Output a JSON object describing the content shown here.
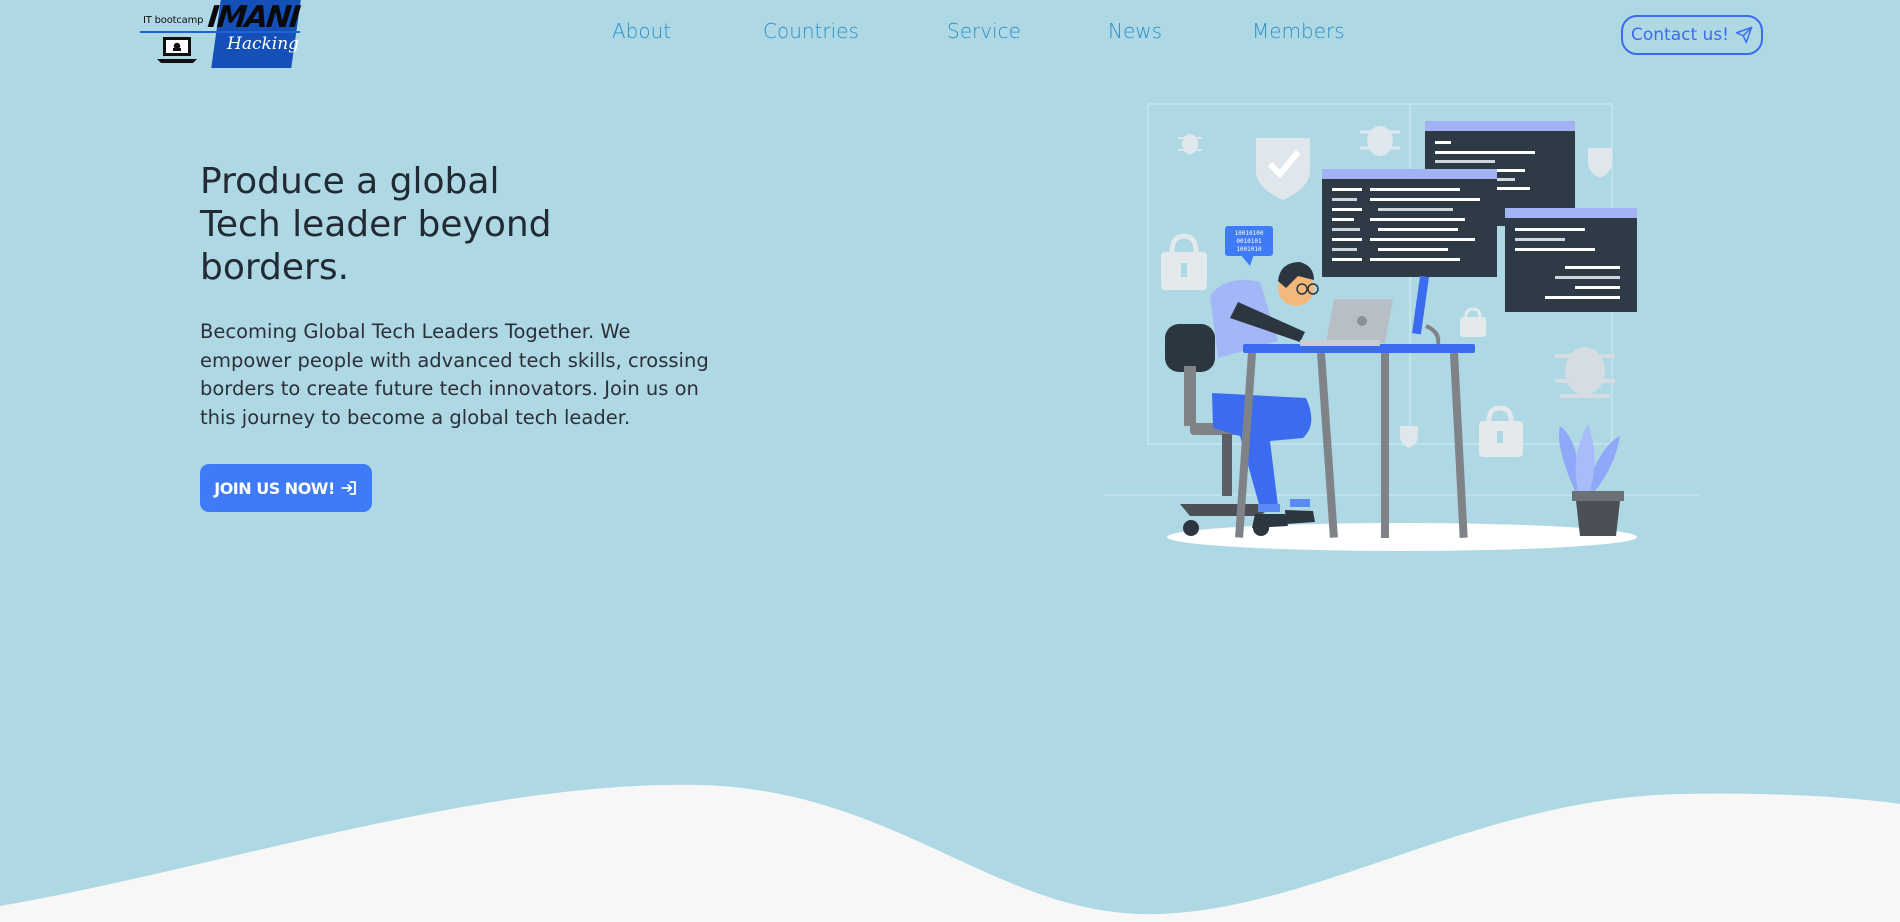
{
  "logo": {
    "tagline": "IT bootcamp",
    "name": "IMANI",
    "script": "Hacking"
  },
  "nav": {
    "items": [
      {
        "label": "About"
      },
      {
        "label": "Countries"
      },
      {
        "label": "Service"
      },
      {
        "label": "News"
      },
      {
        "label": "Members"
      }
    ],
    "contact_label": "Contact us!"
  },
  "hero": {
    "title_lines": [
      "Produce a global",
      "Tech leader beyond",
      "borders."
    ],
    "description": "Becoming Global Tech Leaders Together. We empower people with advanced tech skills, crossing borders to create future tech innovators. Join us on this journey to become a global tech leader.",
    "cta_label": "JOIN US NOW!",
    "speech_bubble_lines": [
      "10010100",
      "0010101",
      "1001010"
    ]
  },
  "icons": {
    "contact": "paper-plane-icon",
    "cta": "sign-in-arrow-icon"
  },
  "colors": {
    "background": "#add8e4",
    "nav_text": "#2d8fc5",
    "accent": "#3f7bf7",
    "heading": "#222a33",
    "footer_wave": "#f7f7f7",
    "logo_blue": "#1450b8"
  }
}
